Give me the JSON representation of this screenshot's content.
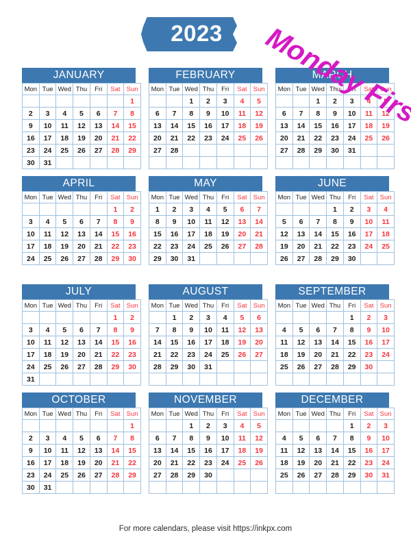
{
  "header": {
    "year": "2023",
    "watermark": "Monday First",
    "banner_color": "#3d78b0",
    "watermark_color": "#d619c4"
  },
  "colors": {
    "header_blue": "#3d78b0",
    "weekend_red": "#f4333d",
    "grid_border": "#9fc0dd",
    "weekday_text": "#1c1c1c"
  },
  "weekdays": [
    "Mon",
    "Tue",
    "Wed",
    "Thu",
    "Fri",
    "Sat",
    "Sun"
  ],
  "weekend_indices": [
    5,
    6
  ],
  "months": [
    {
      "name": "JANUARY",
      "weeks": [
        [
          "",
          "",
          "",
          "",
          "",
          "",
          "1"
        ],
        [
          "2",
          "3",
          "4",
          "5",
          "6",
          "7",
          "8"
        ],
        [
          "9",
          "10",
          "11",
          "12",
          "13",
          "14",
          "15"
        ],
        [
          "16",
          "17",
          "18",
          "19",
          "20",
          "21",
          "22"
        ],
        [
          "23",
          "24",
          "25",
          "26",
          "27",
          "28",
          "29"
        ],
        [
          "30",
          "31",
          "",
          "",
          "",
          "",
          ""
        ]
      ]
    },
    {
      "name": "FEBRUARY",
      "weeks": [
        [
          "",
          "",
          "1",
          "2",
          "3",
          "4",
          "5"
        ],
        [
          "6",
          "7",
          "8",
          "9",
          "10",
          "11",
          "12"
        ],
        [
          "13",
          "14",
          "15",
          "16",
          "17",
          "18",
          "19"
        ],
        [
          "20",
          "21",
          "22",
          "23",
          "24",
          "25",
          "26"
        ],
        [
          "27",
          "28",
          "",
          "",
          "",
          "",
          ""
        ],
        [
          "",
          "",
          "",
          "",
          "",
          "",
          ""
        ]
      ]
    },
    {
      "name": "MARCH",
      "weeks": [
        [
          "",
          "",
          "1",
          "2",
          "3",
          "4",
          "5"
        ],
        [
          "6",
          "7",
          "8",
          "9",
          "10",
          "11",
          "12"
        ],
        [
          "13",
          "14",
          "15",
          "16",
          "17",
          "18",
          "19"
        ],
        [
          "20",
          "21",
          "22",
          "23",
          "24",
          "25",
          "26"
        ],
        [
          "27",
          "28",
          "29",
          "30",
          "31",
          "",
          ""
        ],
        [
          "",
          "",
          "",
          "",
          "",
          "",
          ""
        ]
      ]
    },
    {
      "name": "APRIL",
      "weeks": [
        [
          "",
          "",
          "",
          "",
          "",
          "1",
          "2"
        ],
        [
          "3",
          "4",
          "5",
          "6",
          "7",
          "8",
          "9"
        ],
        [
          "10",
          "11",
          "12",
          "13",
          "14",
          "15",
          "16"
        ],
        [
          "17",
          "18",
          "19",
          "20",
          "21",
          "22",
          "23"
        ],
        [
          "24",
          "25",
          "26",
          "27",
          "28",
          "29",
          "30"
        ]
      ]
    },
    {
      "name": "MAY",
      "weeks": [
        [
          "1",
          "2",
          "3",
          "4",
          "5",
          "6",
          "7"
        ],
        [
          "8",
          "9",
          "10",
          "11",
          "12",
          "13",
          "14"
        ],
        [
          "15",
          "16",
          "17",
          "18",
          "19",
          "20",
          "21"
        ],
        [
          "22",
          "23",
          "24",
          "25",
          "26",
          "27",
          "28"
        ],
        [
          "29",
          "30",
          "31",
          "",
          "",
          "",
          ""
        ]
      ]
    },
    {
      "name": "JUNE",
      "weeks": [
        [
          "",
          "",
          "",
          "1",
          "2",
          "3",
          "4"
        ],
        [
          "5",
          "6",
          "7",
          "8",
          "9",
          "10",
          "11"
        ],
        [
          "12",
          "13",
          "14",
          "15",
          "16",
          "17",
          "18"
        ],
        [
          "19",
          "20",
          "21",
          "22",
          "23",
          "24",
          "25"
        ],
        [
          "26",
          "27",
          "28",
          "29",
          "30",
          "",
          ""
        ]
      ]
    },
    {
      "name": "JULY",
      "weeks": [
        [
          "",
          "",
          "",
          "",
          "",
          "1",
          "2"
        ],
        [
          "3",
          "4",
          "5",
          "6",
          "7",
          "8",
          "9"
        ],
        [
          "10",
          "11",
          "12",
          "13",
          "14",
          "15",
          "16"
        ],
        [
          "17",
          "18",
          "19",
          "20",
          "21",
          "22",
          "23"
        ],
        [
          "24",
          "25",
          "26",
          "27",
          "28",
          "29",
          "30"
        ],
        [
          "31",
          "",
          "",
          "",
          "",
          "",
          ""
        ]
      ]
    },
    {
      "name": "AUGUST",
      "weeks": [
        [
          "",
          "1",
          "2",
          "3",
          "4",
          "5",
          "6"
        ],
        [
          "7",
          "8",
          "9",
          "10",
          "11",
          "12",
          "13"
        ],
        [
          "14",
          "15",
          "16",
          "17",
          "18",
          "19",
          "20"
        ],
        [
          "21",
          "22",
          "23",
          "24",
          "25",
          "26",
          "27"
        ],
        [
          "28",
          "29",
          "30",
          "31",
          "",
          "",
          ""
        ],
        [
          "",
          "",
          "",
          "",
          "",
          "",
          ""
        ]
      ]
    },
    {
      "name": "SEPTEMBER",
      "weeks": [
        [
          "",
          "",
          "",
          "",
          "1",
          "2",
          "3"
        ],
        [
          "4",
          "5",
          "6",
          "7",
          "8",
          "9",
          "10"
        ],
        [
          "11",
          "12",
          "13",
          "14",
          "15",
          "16",
          "17"
        ],
        [
          "18",
          "19",
          "20",
          "21",
          "22",
          "23",
          "24"
        ],
        [
          "25",
          "26",
          "27",
          "28",
          "29",
          "30",
          ""
        ],
        [
          "",
          "",
          "",
          "",
          "",
          "",
          ""
        ]
      ]
    },
    {
      "name": "OCTOBER",
      "weeks": [
        [
          "",
          "",
          "",
          "",
          "",
          "",
          "1"
        ],
        [
          "2",
          "3",
          "4",
          "5",
          "6",
          "7",
          "8"
        ],
        [
          "9",
          "10",
          "11",
          "12",
          "13",
          "14",
          "15"
        ],
        [
          "16",
          "17",
          "18",
          "19",
          "20",
          "21",
          "22"
        ],
        [
          "23",
          "24",
          "25",
          "26",
          "27",
          "28",
          "29"
        ],
        [
          "30",
          "31",
          "",
          "",
          "",
          "",
          ""
        ]
      ]
    },
    {
      "name": "NOVEMBER",
      "weeks": [
        [
          "",
          "",
          "1",
          "2",
          "3",
          "4",
          "5"
        ],
        [
          "6",
          "7",
          "8",
          "9",
          "10",
          "11",
          "12"
        ],
        [
          "13",
          "14",
          "15",
          "16",
          "17",
          "18",
          "19"
        ],
        [
          "20",
          "21",
          "22",
          "23",
          "24",
          "25",
          "26"
        ],
        [
          "27",
          "28",
          "29",
          "30",
          "",
          "",
          ""
        ],
        [
          "",
          "",
          "",
          "",
          "",
          "",
          ""
        ]
      ]
    },
    {
      "name": "DECEMBER",
      "weeks": [
        [
          "",
          "",
          "",
          "",
          "1",
          "2",
          "3"
        ],
        [
          "4",
          "5",
          "6",
          "7",
          "8",
          "9",
          "10"
        ],
        [
          "11",
          "12",
          "13",
          "14",
          "15",
          "16",
          "17"
        ],
        [
          "18",
          "19",
          "20",
          "21",
          "22",
          "23",
          "24"
        ],
        [
          "25",
          "26",
          "27",
          "28",
          "29",
          "30",
          "31"
        ],
        [
          "",
          "",
          "",
          "",
          "",
          "",
          ""
        ]
      ]
    }
  ],
  "footer": {
    "text": "For more calendars, please visit https://inkpx.com"
  }
}
